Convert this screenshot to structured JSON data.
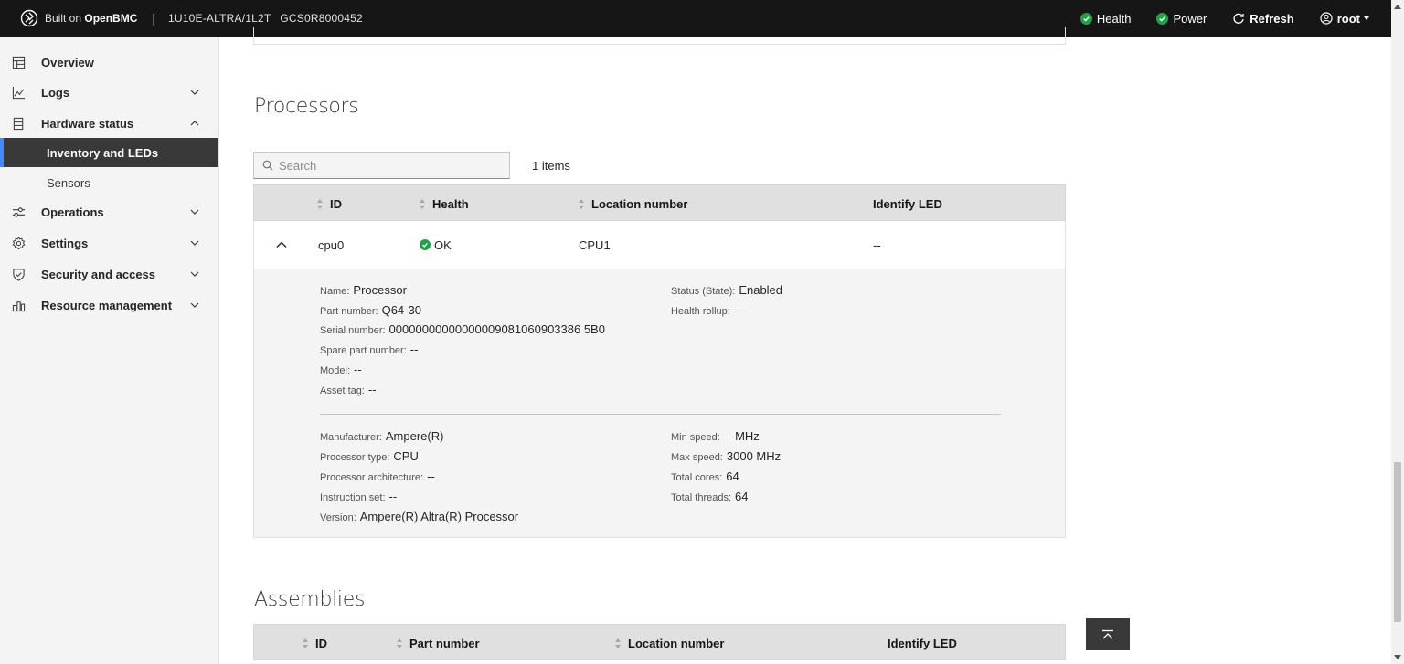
{
  "topbar": {
    "built_on": "Built on",
    "brand": "OpenBMC",
    "separator": "|",
    "model": "1U10E-ALTRA/1L2T",
    "serial": "GCS0R8000452",
    "health_label": "Health",
    "power_label": "Power",
    "refresh_label": "Refresh",
    "user_label": "root",
    "status_color": "#24a148"
  },
  "sidebar": {
    "items": [
      {
        "label": "Overview",
        "icon": "dashboard-icon"
      },
      {
        "label": "Logs",
        "icon": "chart-line-icon"
      },
      {
        "label": "Hardware status",
        "icon": "server-icon"
      },
      {
        "label": "Operations",
        "icon": "sliders-icon"
      },
      {
        "label": "Settings",
        "icon": "gear-icon"
      },
      {
        "label": "Security and access",
        "icon": "shield-icon"
      },
      {
        "label": "Resource management",
        "icon": "chart-bar-icon"
      }
    ],
    "sub_items": [
      {
        "label": "Inventory and LEDs",
        "active": true
      },
      {
        "label": "Sensors",
        "active": false
      }
    ],
    "active_color": "#4589ff"
  },
  "processors": {
    "title": "Processors",
    "search_placeholder": "Search",
    "count": "1 items",
    "columns": [
      "ID",
      "Health",
      "Location number",
      "Identify LED"
    ],
    "row": {
      "id": "cpu0",
      "health": "OK",
      "location": "CPU1",
      "identify_led": "--"
    },
    "details": {
      "name_label": "Name:",
      "name": "Processor",
      "part_number_label": "Part number:",
      "part_number": "Q64-30",
      "serial_label": "Serial number:",
      "serial": "00000000000000009081060903386 5B0",
      "spare_label": "Spare part number:",
      "spare": "--",
      "model_label": "Model:",
      "model": "--",
      "asset_label": "Asset tag:",
      "asset": "--",
      "status_label": "Status (State):",
      "status": "Enabled",
      "health_rollup_label": "Health rollup:",
      "health_rollup": "--",
      "manufacturer_label": "Manufacturer:",
      "manufacturer": "Ampere(R)",
      "proc_type_label": "Processor type:",
      "proc_type": "CPU",
      "proc_arch_label": "Processor architecture:",
      "proc_arch": "--",
      "instruction_label": "Instruction set:",
      "instruction": "--",
      "version_label": "Version:",
      "version": "Ampere(R) Altra(R) Processor",
      "min_speed_label": "Min speed:",
      "min_speed": "-- MHz",
      "max_speed_label": "Max speed:",
      "max_speed": "3000 MHz",
      "cores_label": "Total cores:",
      "cores": "64",
      "threads_label": "Total threads:",
      "threads": "64"
    }
  },
  "assemblies": {
    "title": "Assemblies",
    "columns": [
      "ID",
      "Part number",
      "Location number",
      "Identify LED"
    ]
  }
}
